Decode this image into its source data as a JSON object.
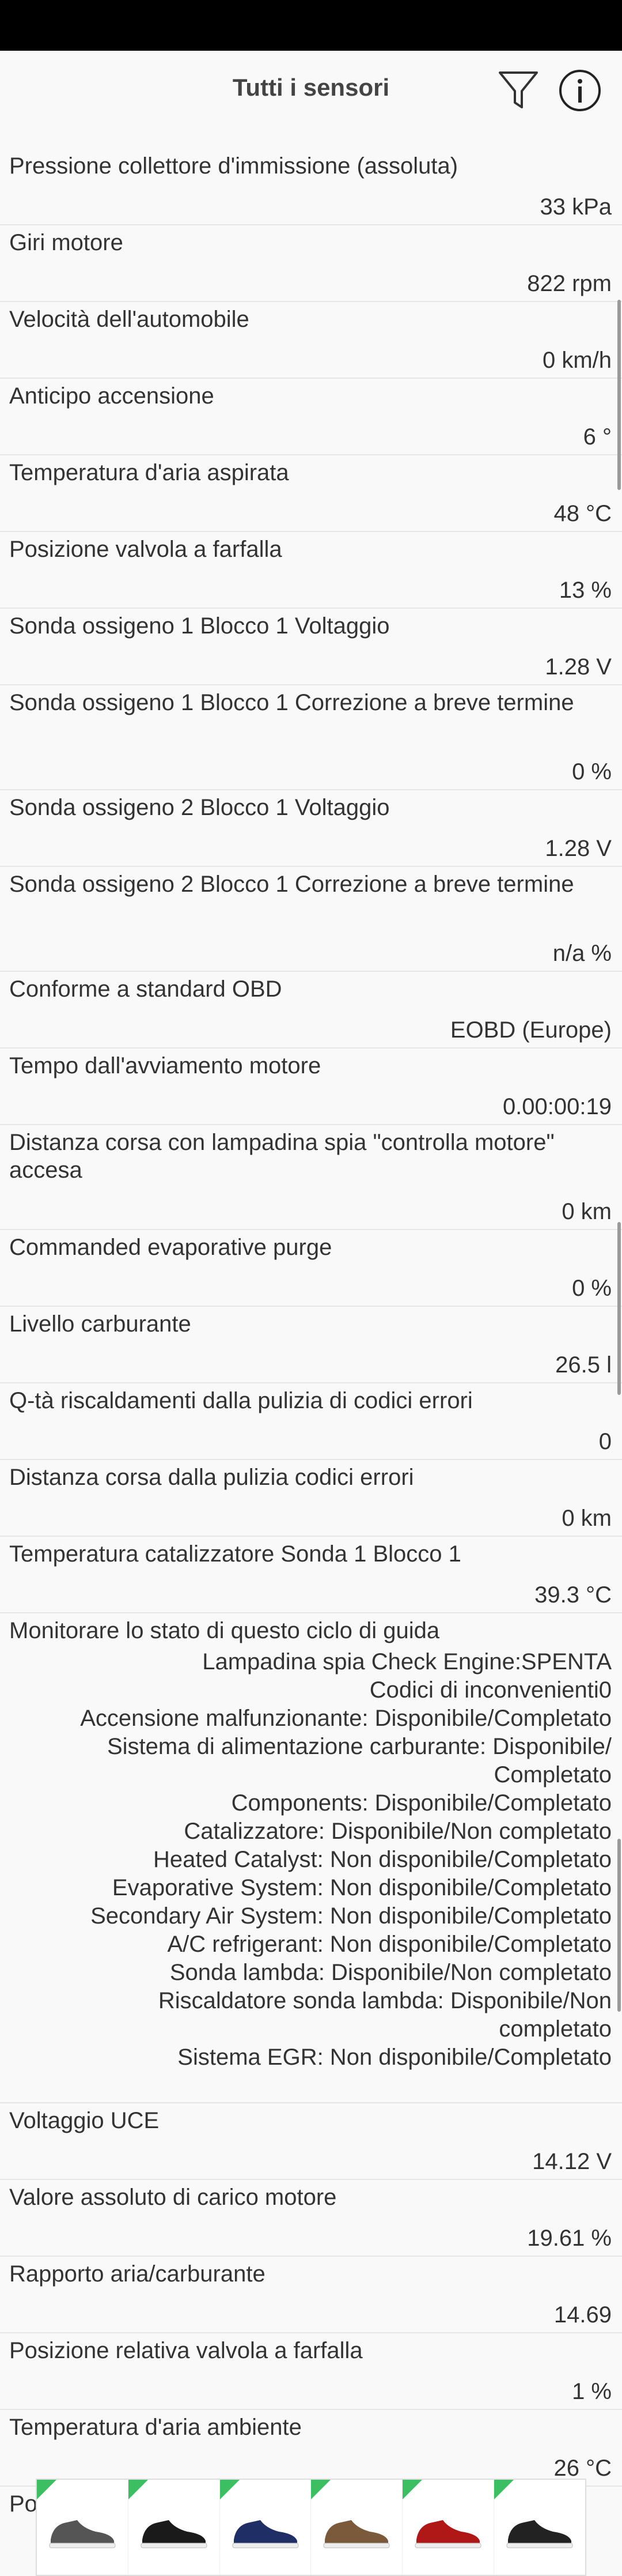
{
  "header": {
    "title": "Tutti i sensori",
    "filter_icon": "filter-icon",
    "info_icon": "info-icon"
  },
  "sensors": [
    {
      "name": "Pressione collettore d'immissione (assoluta)",
      "value": "33 kPa"
    },
    {
      "name": "Giri motore",
      "value": "822 rpm"
    },
    {
      "name": "Velocità dell'automobile",
      "value": "0 km/h"
    },
    {
      "name": "Anticipo accensione",
      "value": "6 °"
    },
    {
      "name": "Temperatura d'aria aspirata",
      "value": "48 °C"
    },
    {
      "name": "Posizione valvola a farfalla",
      "value": "13 %"
    },
    {
      "name": "Sonda ossigeno 1 Blocco 1 Voltaggio",
      "value": "1.28 V"
    },
    {
      "name": "Sonda ossigeno 1 Blocco 1 Correzione a breve termine",
      "value": "0 %"
    },
    {
      "name": "Sonda ossigeno 2 Blocco 1 Voltaggio",
      "value": "1.28 V"
    },
    {
      "name": "Sonda ossigeno 2 Blocco 1 Correzione a breve termine",
      "value": "n/a %"
    },
    {
      "name": "Conforme a standard OBD",
      "value": "EOBD (Europe)"
    },
    {
      "name": "Tempo dall'avviamento motore",
      "value": "0.00:00:19"
    },
    {
      "name": "Distanza corsa con lampadina spia \"controlla motore\" accesa",
      "value": "0 km"
    },
    {
      "name": "Commanded evaporative purge",
      "value": "0 %"
    },
    {
      "name": "Livello carburante",
      "value": "26.5 l"
    },
    {
      "name": "Q-tà riscaldamenti dalla pulizia di codici errori",
      "value": "0"
    },
    {
      "name": "Distanza corsa dalla pulizia codici errori",
      "value": "0 km"
    },
    {
      "name": "Temperatura catalizzatore Sonda 1 Blocco 1",
      "value": "39.3 °C"
    }
  ],
  "monitor": {
    "name": "Monitorare lo stato di questo ciclo di guida",
    "lines": [
      "Lampadina spia Check Engine:SPENTA",
      "Codici di inconvenienti0",
      "Accensione malfunzionante: Disponibile/Completato",
      "Sistema di alimentazione carburante: Disponibile/\nCompletato",
      "Components: Disponibile/Completato",
      "Catalizzatore: Disponibile/Non completato",
      "Heated Catalyst: Non disponibile/Completato",
      "Evaporative System: Non disponibile/Completato",
      "Secondary Air System: Non disponibile/Completato",
      "A/C refrigerant: Non disponibile/Completato",
      "Sonda lambda: Disponibile/Non completato",
      "Riscaldatore sonda lambda: Disponibile/Non\ncompletato",
      "Sistema EGR: Non disponibile/Completato"
    ]
  },
  "sensors_after": [
    {
      "name": "Voltaggio UCE",
      "value": "14.12 V"
    },
    {
      "name": "Valore assoluto di carico motore",
      "value": "19.61 %"
    },
    {
      "name": "Rapporto aria/carburante",
      "value": "14.69"
    },
    {
      "name": "Posizione relativa valvola a farfalla",
      "value": "1 %"
    },
    {
      "name": "Temperatura d'aria ambiente",
      "value": "26 °C"
    }
  ],
  "last_sensor": {
    "name": "Posizione assoluta valvola a farfalla B"
  },
  "ad": {
    "items": [
      "shoe-product-image",
      "shoe-product-image",
      "shoe-product-image",
      "shoe-product-image",
      "shoe-product-image",
      "shoe-product-image"
    ],
    "shoe_colors": [
      "#555555",
      "#1a1a1a",
      "#1f2f66",
      "#7a5a3a",
      "#b01818",
      "#222222"
    ]
  }
}
